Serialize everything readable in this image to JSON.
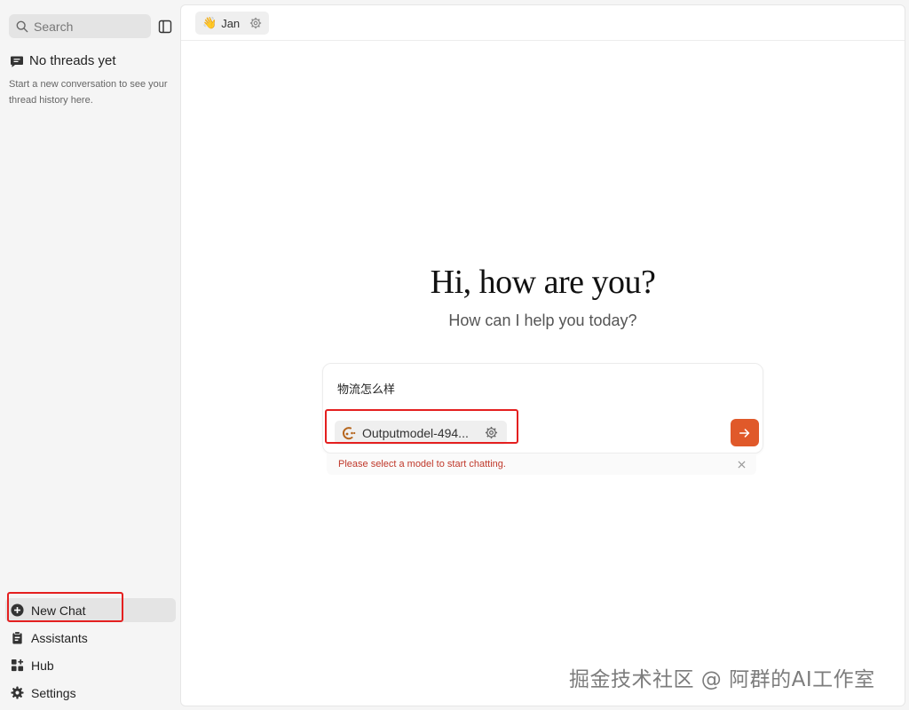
{
  "sidebar": {
    "search_placeholder": "Search",
    "empty_state": {
      "title": "No threads yet",
      "description": "Start a new conversation to see your thread history here."
    },
    "nav": [
      {
        "label": "New Chat",
        "icon": "plus-circle-icon",
        "active": true
      },
      {
        "label": "Assistants",
        "icon": "clipboard-icon"
      },
      {
        "label": "Hub",
        "icon": "grid-plus-icon"
      },
      {
        "label": "Settings",
        "icon": "gear-icon"
      }
    ]
  },
  "header": {
    "assistant": {
      "emoji": "👋",
      "name": "Jan"
    }
  },
  "main": {
    "greeting": "Hi, how are you?",
    "subtitle": "How can I help you today?",
    "composer": {
      "input_value": "物流怎么样",
      "model_name": "Outputmodel-494...",
      "error": "Please select a model to start chatting."
    }
  },
  "watermark": "掘金技术社区 @ 阿群的AI工作室",
  "colors": {
    "accent": "#e0592a",
    "error": "#c0392b",
    "highlight_box": "#e41f1f"
  }
}
